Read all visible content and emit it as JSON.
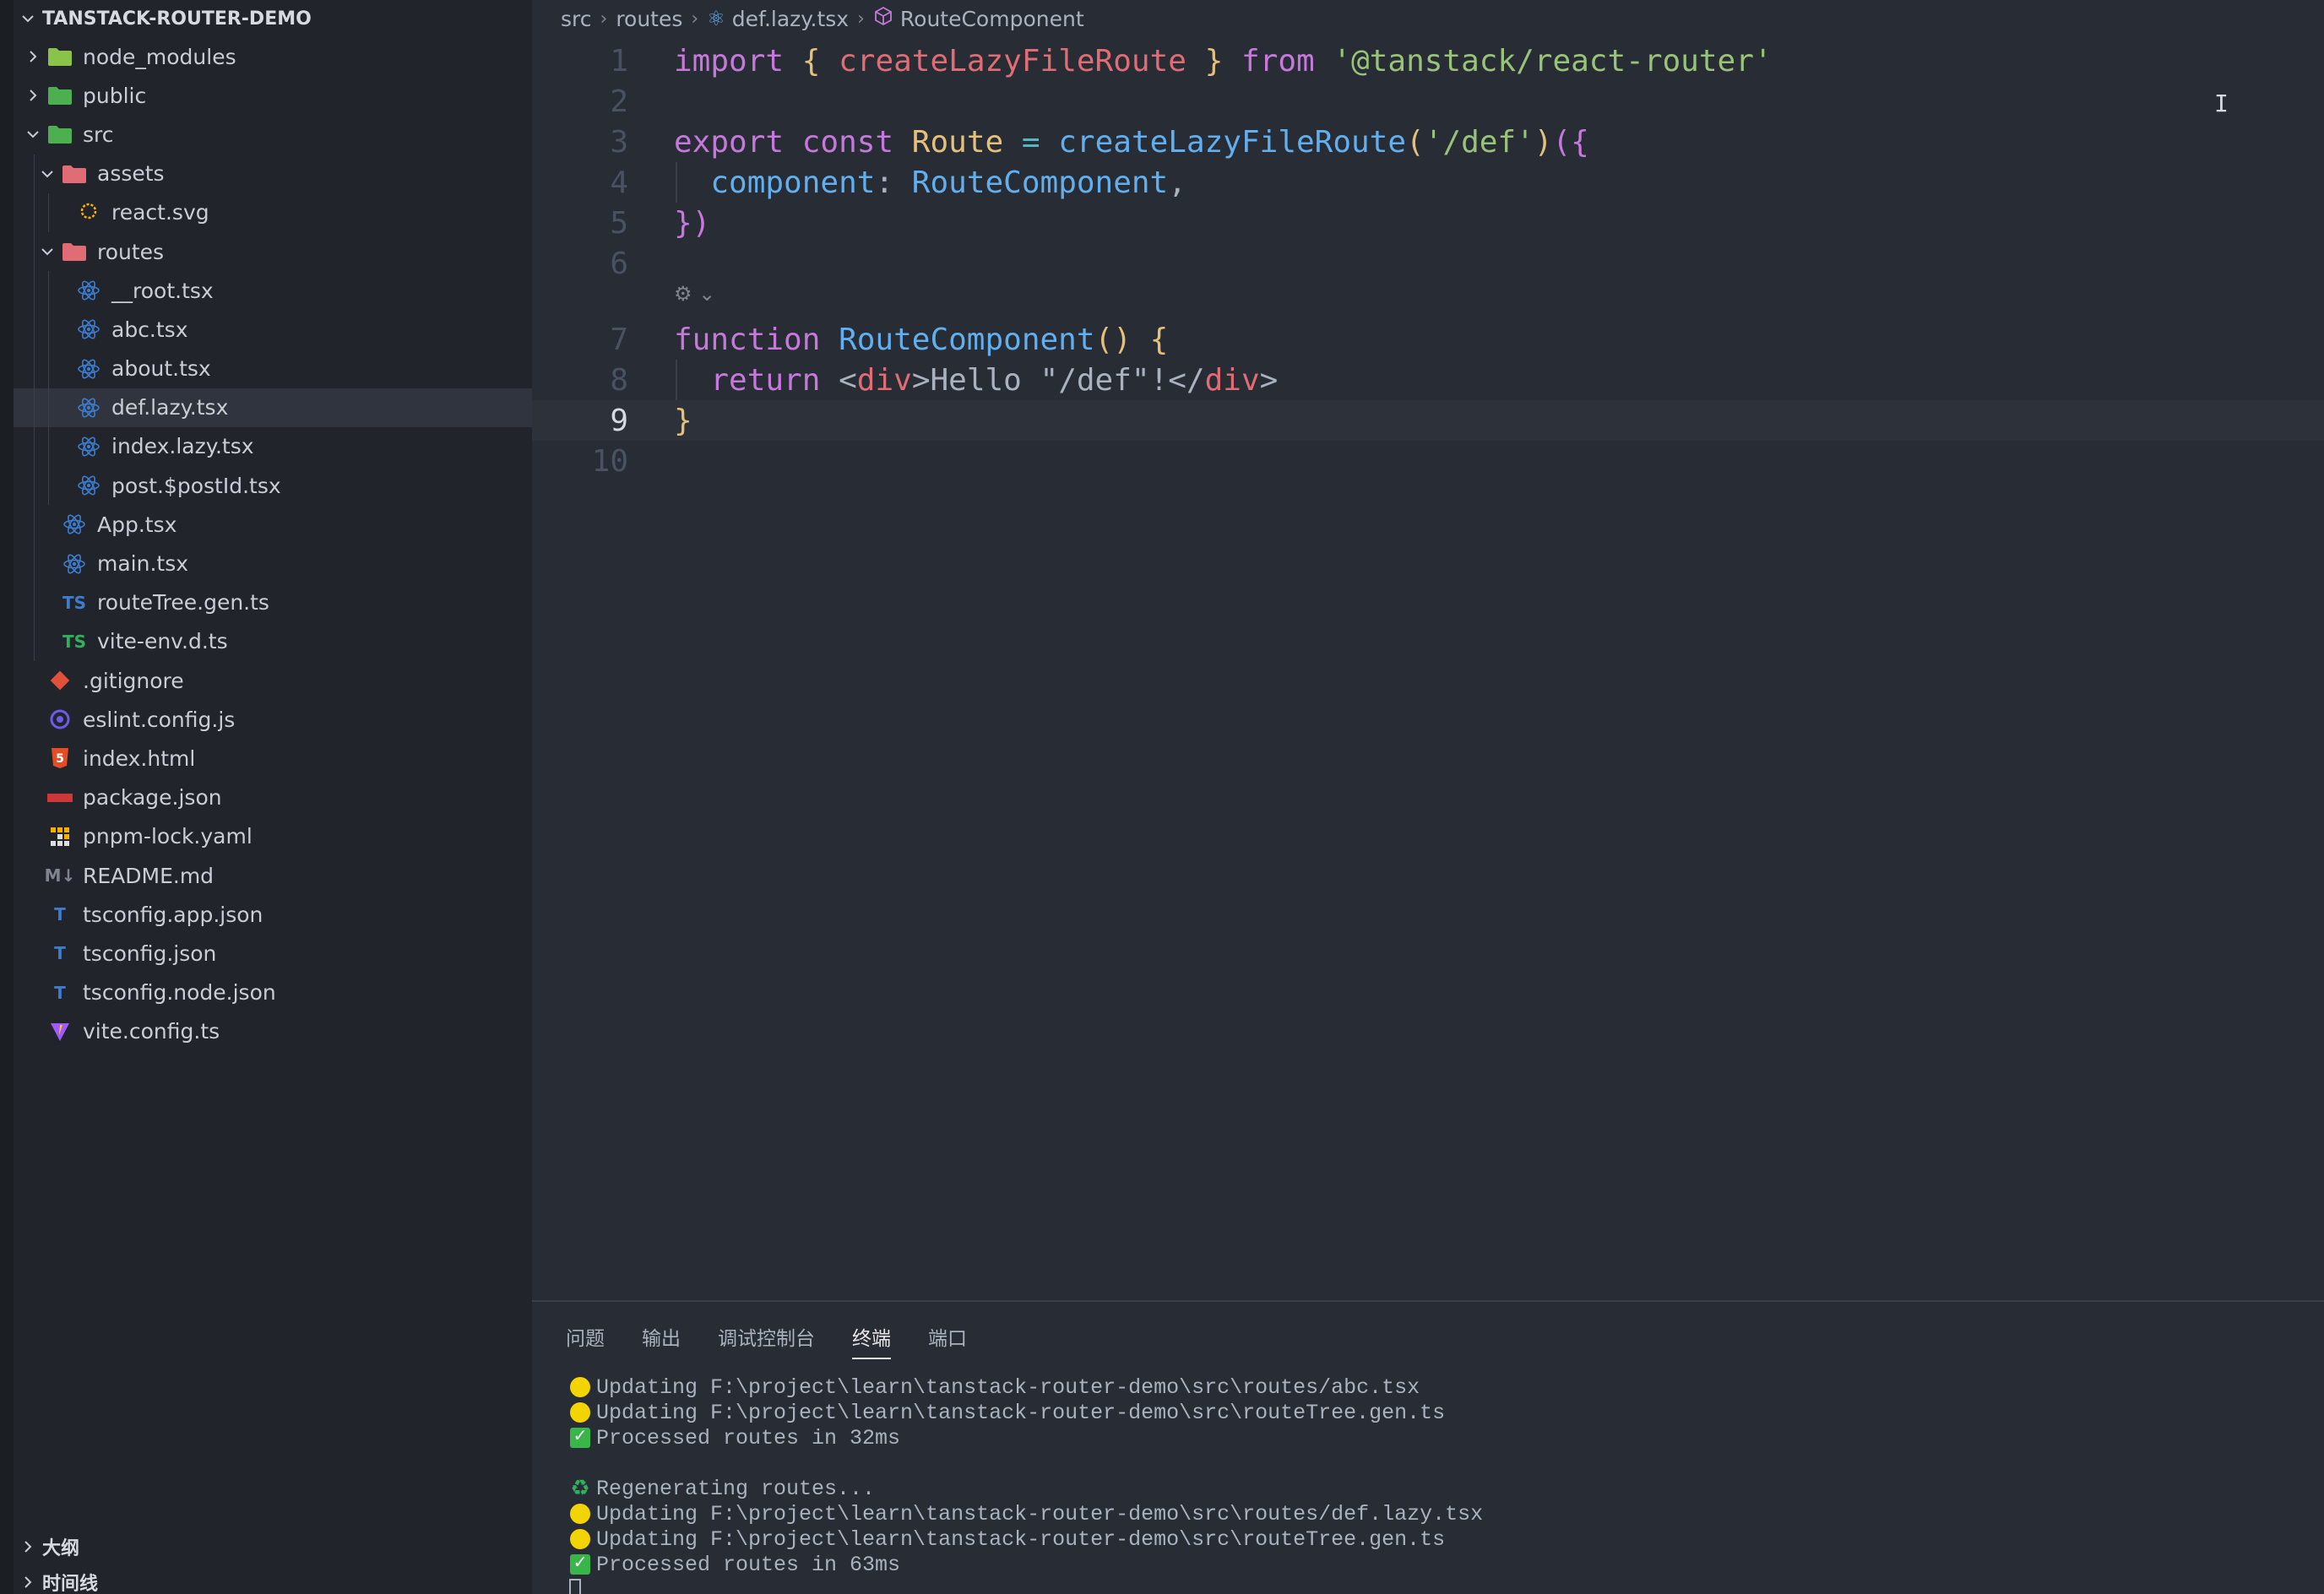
{
  "explorer": {
    "root_title": "TANSTACK-ROUTER-DEMO",
    "items": [
      {
        "label": "node_modules",
        "depth": 1,
        "twist": "closed",
        "icon": "folder-node-icon",
        "color": "#8bc34a"
      },
      {
        "label": "public",
        "depth": 1,
        "twist": "closed",
        "icon": "folder-public-icon",
        "color": "#4caf50"
      },
      {
        "label": "src",
        "depth": 1,
        "twist": "open",
        "icon": "folder-src-icon",
        "color": "#4caf50"
      },
      {
        "label": "assets",
        "depth": 2,
        "twist": "open",
        "icon": "folder-assets-icon",
        "color": "#e06c75"
      },
      {
        "label": "react.svg",
        "depth": 3,
        "twist": "none",
        "icon": "svg-file-icon",
        "color": "#ffb300"
      },
      {
        "label": "routes",
        "depth": 2,
        "twist": "open",
        "icon": "folder-routes-icon",
        "color": "#e06c75"
      },
      {
        "label": "__root.tsx",
        "depth": 3,
        "twist": "none",
        "icon": "react-icon",
        "color": "#3d7ccf"
      },
      {
        "label": "abc.tsx",
        "depth": 3,
        "twist": "none",
        "icon": "react-icon",
        "color": "#3d7ccf"
      },
      {
        "label": "about.tsx",
        "depth": 3,
        "twist": "none",
        "icon": "react-icon",
        "color": "#3d7ccf"
      },
      {
        "label": "def.lazy.tsx",
        "depth": 3,
        "twist": "none",
        "icon": "react-icon",
        "color": "#3d7ccf",
        "selected": true
      },
      {
        "label": "index.lazy.tsx",
        "depth": 3,
        "twist": "none",
        "icon": "react-icon",
        "color": "#3d7ccf"
      },
      {
        "label": "post.$postId.tsx",
        "depth": 3,
        "twist": "none",
        "icon": "react-icon",
        "color": "#3d7ccf"
      },
      {
        "label": "App.tsx",
        "depth": 2,
        "twist": "none",
        "icon": "react-icon",
        "color": "#3d7ccf"
      },
      {
        "label": "main.tsx",
        "depth": 2,
        "twist": "none",
        "icon": "react-icon",
        "color": "#3d7ccf"
      },
      {
        "label": "routeTree.gen.ts",
        "depth": 2,
        "twist": "none",
        "icon": "ts-icon",
        "glyph": "TS",
        "color": "#3d7ccf"
      },
      {
        "label": "vite-env.d.ts",
        "depth": 2,
        "twist": "none",
        "icon": "ts-def-icon",
        "glyph": "TS",
        "color": "#2fb05a"
      },
      {
        "label": ".gitignore",
        "depth": 1,
        "twist": "none",
        "icon": "git-icon",
        "color": "#e0503a"
      },
      {
        "label": "eslint.config.js",
        "depth": 1,
        "twist": "none",
        "icon": "eslint-icon",
        "color": "#6c5ce7"
      },
      {
        "label": "index.html",
        "depth": 1,
        "twist": "none",
        "icon": "html-icon",
        "glyph": "5",
        "color": "#e44d26"
      },
      {
        "label": "package.json",
        "depth": 1,
        "twist": "none",
        "icon": "npm-icon",
        "color": "#cb3837"
      },
      {
        "label": "pnpm-lock.yaml",
        "depth": 1,
        "twist": "none",
        "icon": "pnpm-icon",
        "color": "#f9ad00"
      },
      {
        "label": "README.md",
        "depth": 1,
        "twist": "none",
        "icon": "markdown-icon",
        "glyph": "M↓",
        "color": "#7f848e"
      },
      {
        "label": "tsconfig.app.json",
        "depth": 1,
        "twist": "none",
        "icon": "tsconfig-icon",
        "glyph": "T",
        "color": "#3d7ccf"
      },
      {
        "label": "tsconfig.json",
        "depth": 1,
        "twist": "none",
        "icon": "tsconfig-icon",
        "glyph": "T",
        "color": "#3d7ccf"
      },
      {
        "label": "tsconfig.node.json",
        "depth": 1,
        "twist": "none",
        "icon": "tsconfig-icon",
        "glyph": "T",
        "color": "#3d7ccf"
      },
      {
        "label": "vite.config.ts",
        "depth": 1,
        "twist": "none",
        "icon": "vite-icon",
        "color": "#a259ff"
      }
    ],
    "outline_label": "大纲",
    "timeline_label": "时间线"
  },
  "breadcrumb": {
    "parts": [
      "src",
      "routes",
      "def.lazy.tsx",
      "RouteComponent"
    ]
  },
  "editor": {
    "active_line": 9,
    "lines": [
      {
        "num": "1",
        "tokens": [
          [
            "kw",
            "import"
          ],
          [
            "pl",
            " "
          ],
          [
            "br1",
            "{"
          ],
          [
            "pl",
            " "
          ],
          [
            "tag",
            "createLazyFileRoute"
          ],
          [
            "pl",
            " "
          ],
          [
            "br1",
            "}"
          ],
          [
            "pl",
            " "
          ],
          [
            "kw",
            "from"
          ],
          [
            "pl",
            " "
          ],
          [
            "str",
            "'@tanstack/react-router'"
          ]
        ]
      },
      {
        "num": "2",
        "tokens": []
      },
      {
        "num": "3",
        "tokens": [
          [
            "kw",
            "export"
          ],
          [
            "pl",
            " "
          ],
          [
            "kw",
            "const"
          ],
          [
            "pl",
            " "
          ],
          [
            "var",
            "Route"
          ],
          [
            "pl",
            " "
          ],
          [
            "op",
            "="
          ],
          [
            "pl",
            " "
          ],
          [
            "fn",
            "createLazyFileRoute"
          ],
          [
            "br1",
            "("
          ],
          [
            "str",
            "'/def'"
          ],
          [
            "br1",
            ")"
          ],
          [
            "br2",
            "({"
          ]
        ]
      },
      {
        "num": "4",
        "indent": true,
        "tokens": [
          [
            "pl",
            "  "
          ],
          [
            "prop",
            "component"
          ],
          [
            "pl",
            ": "
          ],
          [
            "fn",
            "RouteComponent"
          ],
          [
            "pl",
            ","
          ]
        ]
      },
      {
        "num": "5",
        "tokens": [
          [
            "br2",
            "})"
          ]
        ]
      },
      {
        "num": "6",
        "tokens": []
      },
      {
        "num": "7",
        "tokens": [
          [
            "kw",
            "function"
          ],
          [
            "pl",
            " "
          ],
          [
            "fn",
            "RouteComponent"
          ],
          [
            "br1",
            "()"
          ],
          [
            "pl",
            " "
          ],
          [
            "br1",
            "{"
          ]
        ]
      },
      {
        "num": "8",
        "indent": true,
        "tokens": [
          [
            "pl",
            "  "
          ],
          [
            "kw",
            "return"
          ],
          [
            "pl",
            " "
          ],
          [
            "txt",
            "<"
          ],
          [
            "tag",
            "div"
          ],
          [
            "txt",
            ">Hello \"/def\"!</"
          ],
          [
            "tag",
            "div"
          ],
          [
            "txt",
            ">"
          ]
        ]
      },
      {
        "num": "9",
        "tokens": [
          [
            "br1",
            "}"
          ]
        ]
      },
      {
        "num": "10",
        "tokens": []
      }
    ]
  },
  "panel": {
    "tabs": [
      "问题",
      "输出",
      "调试控制台",
      "终端",
      "端口"
    ],
    "active_tab": "终端",
    "terminal": [
      {
        "icon": "yellow-circle-icon",
        "text": "Updating F:\\project\\learn\\tanstack-router-demo\\src\\routes/abc.tsx"
      },
      {
        "icon": "yellow-circle-icon",
        "text": "Updating F:\\project\\learn\\tanstack-router-demo\\src\\routeTree.gen.ts"
      },
      {
        "icon": "check-mark-icon",
        "text": "Processed routes in 32ms"
      },
      {
        "icon": "",
        "text": ""
      },
      {
        "icon": "recycle-icon",
        "text": "Regenerating routes..."
      },
      {
        "icon": "yellow-circle-icon",
        "text": "Updating F:\\project\\learn\\tanstack-router-demo\\src\\routes/def.lazy.tsx"
      },
      {
        "icon": "yellow-circle-icon",
        "text": "Updating F:\\project\\learn\\tanstack-router-demo\\src\\routeTree.gen.ts"
      },
      {
        "icon": "check-mark-icon",
        "text": "Processed routes in 63ms"
      }
    ]
  }
}
